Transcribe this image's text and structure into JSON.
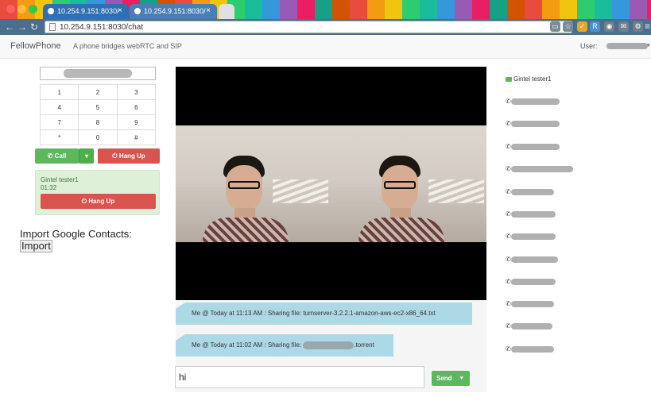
{
  "browser": {
    "tabs": [
      {
        "title": "10.254.9.151:8030/"
      },
      {
        "title": "10.254.9.151:8030/"
      }
    ],
    "url": "10.254.9.151:8030/chat"
  },
  "navbar": {
    "brand": "FellowPhone",
    "tagline": "A phone bridges webRTC and SIP",
    "user_label": "User:"
  },
  "dialer": {
    "keys": [
      [
        "1",
        "2",
        "3"
      ],
      [
        "4",
        "5",
        "6"
      ],
      [
        "7",
        "8",
        "9"
      ],
      [
        "*",
        "0",
        "#"
      ]
    ],
    "call_label": "Call",
    "hangup_label": "Hang Up"
  },
  "active_call": {
    "name": "Gintel tester1",
    "duration": "01:32",
    "hangup_label": "Hang Up"
  },
  "import": {
    "title": "Import Google Contacts:",
    "button": "Import"
  },
  "chat": {
    "messages": [
      {
        "text": "Me @ Today at 11:13 AM : Sharing file: turnserver-3.2.2.1-amazon-aws-ec2-x86_64.txt"
      },
      {
        "prefix": "Me @ Today at 11:02 AM : Sharing file: ",
        "suffix": ".torrent"
      }
    ],
    "input_value": "hi",
    "send_label": "Send"
  },
  "contacts": {
    "active": "Gintel tester1"
  },
  "colors": {
    "primary_green": "#5cb85c",
    "danger_red": "#d9534f",
    "message_blue": "#add8e6"
  }
}
